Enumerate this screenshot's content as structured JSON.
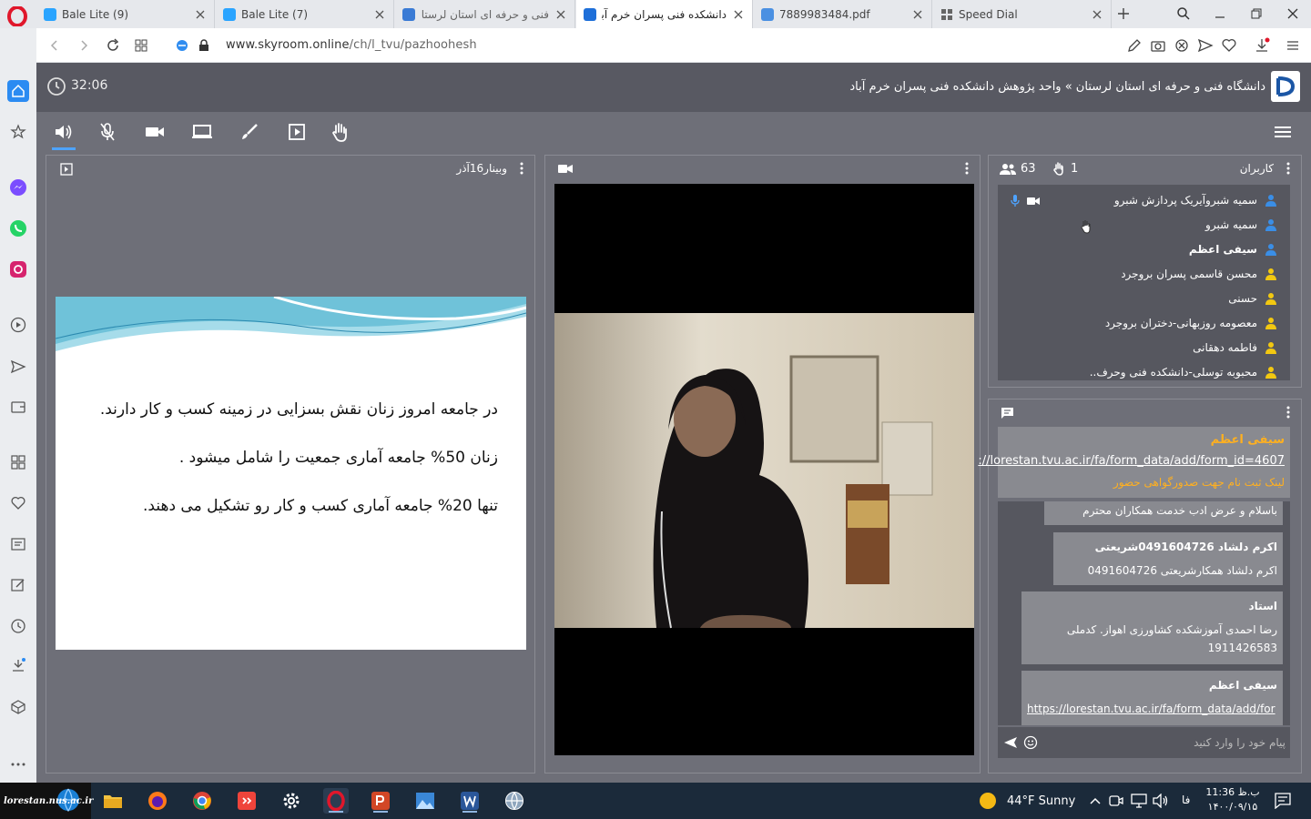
{
  "browser": {
    "tabs": [
      {
        "title": "Bale Lite (9)",
        "badge": "9"
      },
      {
        "title": "Bale Lite (7)",
        "badge": "7"
      },
      {
        "title": "فنی و حرفه ای استان لرستان"
      },
      {
        "title": "دانشکده فنی پسران خرم آباد"
      },
      {
        "title": "7889983484.pdf"
      },
      {
        "title": "Speed Dial"
      }
    ],
    "url_host": "www.skyroom.online",
    "url_path": "/ch/l_tvu/pazhoohesh"
  },
  "header": {
    "timer": "32:06",
    "breadcrumb": "دانشگاه فنی و حرفه ای استان لرستان » واحد پژوهش دانشکده فنی پسران خرم آباد"
  },
  "presentation": {
    "title": "وبینار16آذر",
    "lines": [
      "در جامعه امروز زنان نقش بسزایی در زمینه کسب و کار دارند.",
      "زنان 50% جامعه آماری جمعیت را شامل میشود .",
      "تنها 20% جامعه آماری کسب و کار رو تشکیل می دهند."
    ]
  },
  "users": {
    "title": "کاربران",
    "count": "63",
    "raised_hands": "1",
    "list": [
      {
        "name": "سمیه شبروآیریک پردازش شبرو",
        "role": "blue"
      },
      {
        "name": "سمیه شبرو",
        "role": "blue"
      },
      {
        "name": "سیفی اعظم",
        "role": "blue"
      },
      {
        "name": "محسن قاسمی پسران بروجرد",
        "role": "yellow"
      },
      {
        "name": "حسنی",
        "role": "yellow"
      },
      {
        "name": "معصومه روزبهانی-دختران بروجرد",
        "role": "yellow"
      },
      {
        "name": "فاطمه دهقانی",
        "role": "yellow"
      },
      {
        "name": "محبوبه توسلی-دانشکده فنی وحرف..",
        "role": "yellow"
      }
    ]
  },
  "chat": {
    "pinned": {
      "name": "سیفی اعظم",
      "link": "://lorestan.tvu.ac.ir/fa/form_data/add/form_id=4607",
      "note": "لینک ثبت نام  جهت صدورگواهی حضور"
    },
    "messages": [
      {
        "text": "باسلام و عرض ادب خدمت همکاران محترم"
      },
      {
        "name": "اکرم دلشاد 0491604726شریعتی",
        "text": "اکرم دلشاد همکارشریعتی 0491604726"
      },
      {
        "name": "استاد",
        "text": "رضا احمدی آموزشکده کشاورزی اهواز. کدملی",
        "text2": "1911426583"
      },
      {
        "name": "سیفی اعظم",
        "link": "https://lorestan.tvu.ac.ir/fa/form_data/add/for"
      }
    ],
    "placeholder": "پیام خود را وارد کنید"
  },
  "taskbar": {
    "start_label": "lorestan.nus.ac.ir",
    "weather": "44°F  Sunny",
    "lang": "فا",
    "time": "11:36 ب.ظ",
    "date": "۱۴۰۰/۰۹/۱۵"
  },
  "colors": {
    "accent": "#4ea3ff",
    "user_blue": "#3a8ee6",
    "user_yellow": "#f2c811",
    "pin_name": "#ffb020"
  }
}
